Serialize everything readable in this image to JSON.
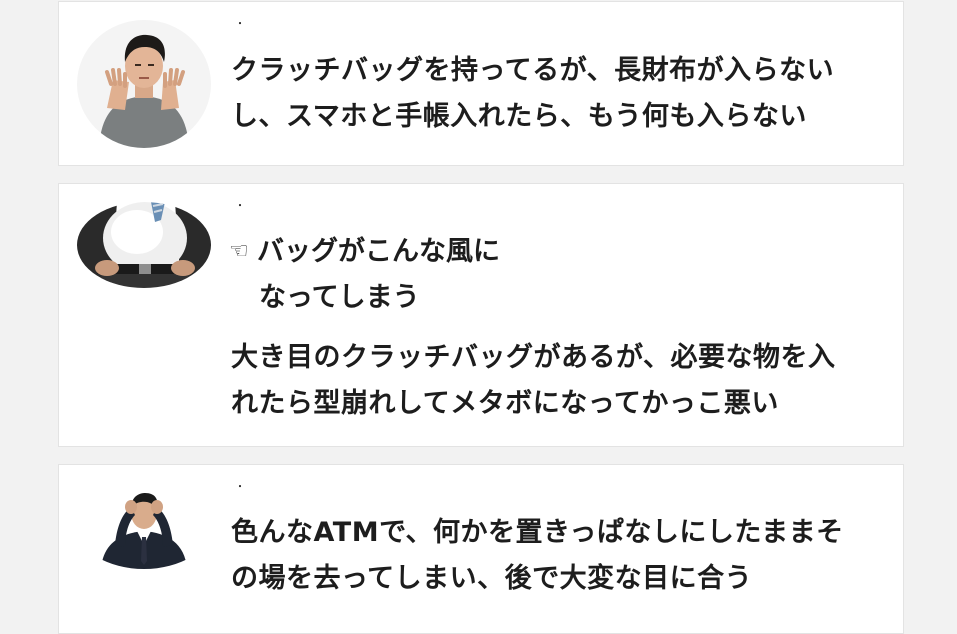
{
  "cards": [
    {
      "dot": "・",
      "lines": [
        "クラッチバッグを持ってるが、長財布が入らない",
        "し、スマホと手帳入れたら、もう何も入らない"
      ]
    },
    {
      "dot": "・",
      "pointer_icon": "☜",
      "note_lines": [
        "バッグがこんな風に",
        "なってしまう"
      ],
      "lines": [
        "大き目のクラッチバッグがあるが、必要な物を入",
        "れたら型崩れしてメタボになってかっこ悪い"
      ]
    },
    {
      "dot": "・",
      "lines": [
        "色んなATMで、何かを置きっぱなしにしたままそ",
        "の場を去ってしまい、後で大変な目に合う"
      ]
    }
  ]
}
